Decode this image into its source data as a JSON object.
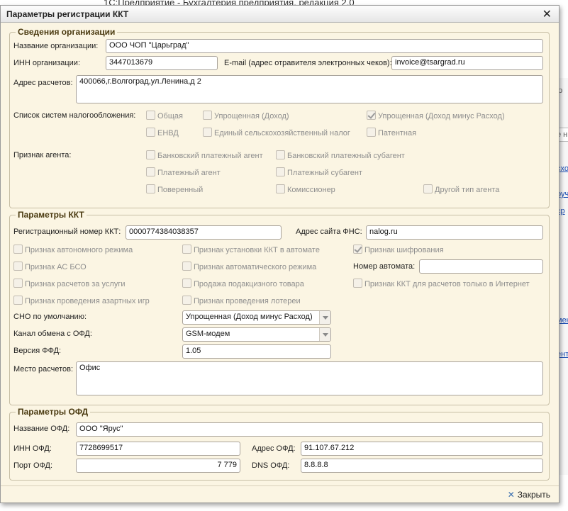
{
  "background": {
    "app_title": "1С:Предприятие - Бухгалтерия предприятия, редакция 2.0",
    "right_fragments": [
      "ю",
      "е н",
      "схо",
      "руч",
      "ср",
      "мен",
      "ент"
    ]
  },
  "dialog": {
    "title": "Параметры регистрации ККТ",
    "close_glyph": "✕"
  },
  "org": {
    "legend": "Сведения организации",
    "name_label": "Название организации:",
    "name_value": "ООО ЧОП \"Царьград\"",
    "inn_label": "ИНН организации:",
    "inn_value": "3447013679",
    "email_label": "E-mail (адрес отравителя электронных чеков):",
    "email_value": "invoice@tsargrad.ru",
    "address_label": "Адрес расчетов:",
    "address_value": "400066,г.Волгоград,ул.Ленина,д 2",
    "tax_label": "Список систем налогообложения:",
    "tax_options": [
      {
        "label": "Общая",
        "checked": false
      },
      {
        "label": "Упрощенная (Доход)",
        "checked": false
      },
      {
        "label": "Упрощенная (Доход минус Расход)",
        "checked": true
      },
      {
        "label": "ЕНВД",
        "checked": false
      },
      {
        "label": "Единый сельскохозяйственный налог",
        "checked": false
      },
      {
        "label": "Патентная",
        "checked": false
      }
    ],
    "agent_label": "Признак агента:",
    "agent_options": [
      {
        "label": "Банковский платежный агент",
        "checked": false
      },
      {
        "label": "Банковский платежный субагент",
        "checked": false
      },
      {
        "label": "Платежный агент",
        "checked": false
      },
      {
        "label": "Платежный субагент",
        "checked": false
      },
      {
        "label": "Поверенный",
        "checked": false
      },
      {
        "label": "Комиссионер",
        "checked": false
      },
      {
        "label": "Другой тип агента",
        "checked": false
      }
    ]
  },
  "kkt": {
    "legend": "Параметры ККТ",
    "reg_label": "Регистрационный номер ККТ:",
    "reg_value": "0000774384038357",
    "fns_label": "Адрес сайта ФНС:",
    "fns_value": "nalog.ru",
    "flags": [
      {
        "label": "Признак автономного режима",
        "checked": false
      },
      {
        "label": "Признак установки ККТ в автомате",
        "checked": false
      },
      {
        "label": "Признак шифрования",
        "checked": true
      },
      {
        "label": "Признак АС БСО",
        "checked": false
      },
      {
        "label": "Признак автоматического режима",
        "checked": false
      },
      {
        "label": "Признак расчетов за услуги",
        "checked": false
      },
      {
        "label": "Продажа подакцизного товара",
        "checked": false
      },
      {
        "label": "Признак ККТ для расчетов только в Интернет",
        "checked": false
      },
      {
        "label": "Признак проведения азартных игр",
        "checked": false
      },
      {
        "label": "Признак проведения лотереи",
        "checked": false
      }
    ],
    "machine_label": "Номер автомата:",
    "machine_value": "",
    "sno_label": "СНО по умолчанию:",
    "sno_value": "Упрощенная (Доход минус Расход)",
    "channel_label": "Канал обмена с ОФД:",
    "channel_value": "GSM-модем",
    "version_label": "Версия ФФД:",
    "version_value": "1.05",
    "place_label": "Место расчетов:",
    "place_value": "Офис"
  },
  "ofd": {
    "legend": "Параметры ОФД",
    "name_label": "Название ОФД:",
    "name_value": "ООО \"Ярус\"",
    "inn_label": "ИНН ОФД:",
    "inn_value": "7728699517",
    "address_label": "Адрес ОФД:",
    "address_value": "91.107.67.212",
    "port_label": "Порт ОФД:",
    "port_value": "7 779",
    "dns_label": "DNS ОФД:",
    "dns_value": "8.8.8.8"
  },
  "footer": {
    "close_label": "Закрыть"
  }
}
